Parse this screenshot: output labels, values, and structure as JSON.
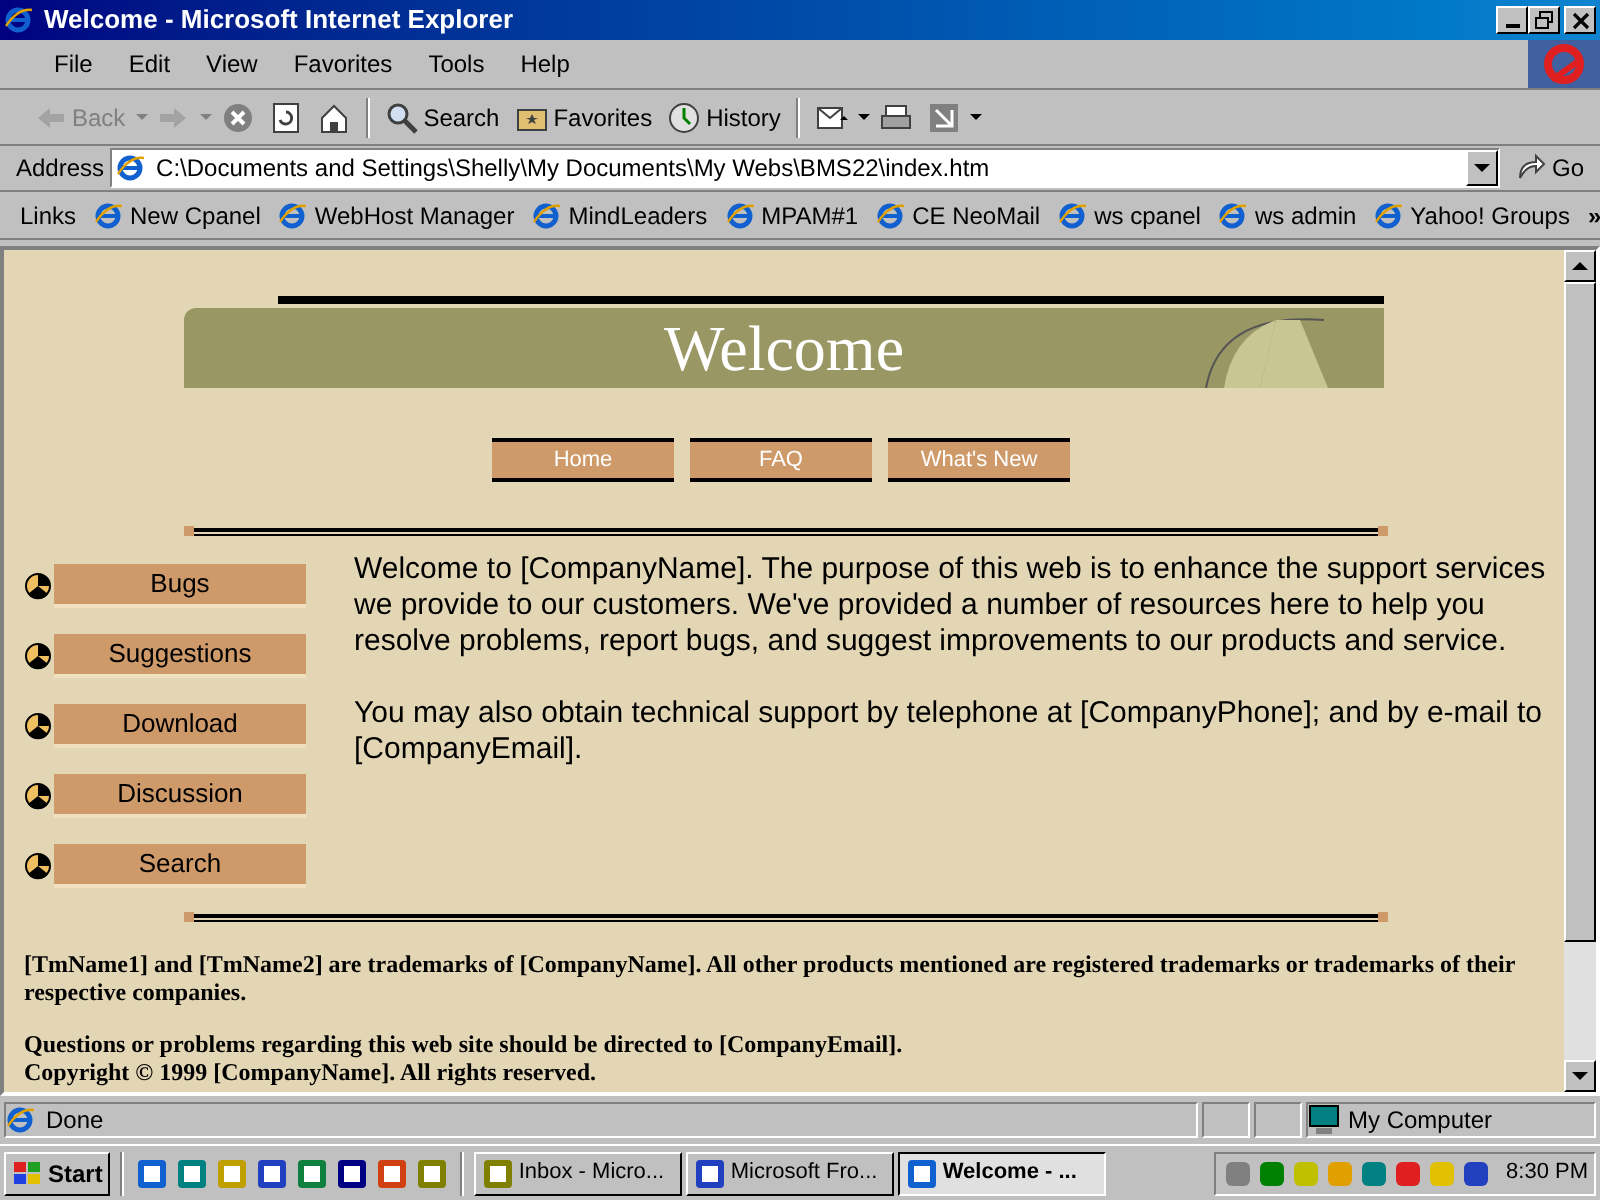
{
  "window": {
    "title": "Welcome - Microsoft Internet Explorer"
  },
  "menu": [
    "File",
    "Edit",
    "View",
    "Favorites",
    "Tools",
    "Help"
  ],
  "toolbar": [
    {
      "kind": "back",
      "label": "Back",
      "disabled": true
    },
    {
      "kind": "forward",
      "disabled": true
    },
    {
      "kind": "stop",
      "disabled": false
    },
    {
      "kind": "refresh",
      "disabled": false
    },
    {
      "kind": "home",
      "disabled": false
    },
    {
      "kind": "search",
      "label": "Search",
      "disabled": false
    },
    {
      "kind": "favorites",
      "label": "Favorites",
      "disabled": false
    },
    {
      "kind": "history",
      "label": "History",
      "disabled": false
    },
    {
      "kind": "mail",
      "disabled": false
    },
    {
      "kind": "print",
      "disabled": false
    },
    {
      "kind": "edit",
      "disabled": false
    }
  ],
  "address": {
    "label": "Address",
    "value": "C:\\Documents and Settings\\Shelly\\My Documents\\My Webs\\BMS22\\index.htm",
    "go": "Go"
  },
  "links": {
    "label": "Links",
    "items": [
      "New Cpanel",
      "WebHost Manager",
      "MindLeaders",
      "MPAM#1",
      "CE NeoMail",
      "ws cpanel",
      "ws admin",
      "Yahoo! Groups"
    ],
    "more": "»"
  },
  "page": {
    "banner": "Welcome",
    "top_nav": [
      "Home",
      "FAQ",
      "What's New"
    ],
    "side_nav": [
      "Bugs",
      "Suggestions",
      "Download",
      "Discussion",
      "Search"
    ],
    "paragraphs": [
      "Welcome to [CompanyName]. The purpose of this web is to enhance the support services we provide to our customers. We've provided a number of resources here to help you resolve problems, report bugs, and suggest improvements to our products and service.",
      "You may also obtain technical support by telephone at [CompanyPhone]; and by e-mail to [CompanyEmail]."
    ],
    "footer": [
      "[TmName1] and [TmName2] are trademarks of [CompanyName]. All other products mentioned are registered trademarks or trademarks of their respective companies.",
      "Questions or problems regarding this web site should be directed to [CompanyEmail].",
      "Copyright © 1999 [CompanyName]. All rights reserved."
    ]
  },
  "status_bar": {
    "text": "Done",
    "zone": "My Computer"
  },
  "taskbar": {
    "start": "Start",
    "quick_launch": [
      {
        "color": "#1060d0"
      },
      {
        "color": "#008080"
      },
      {
        "color": "#c0a000"
      },
      {
        "color": "#2040c0"
      },
      {
        "color": "#108040"
      },
      {
        "color": "#000080"
      },
      {
        "color": "#d04010"
      },
      {
        "color": "#808000"
      }
    ],
    "tasks": [
      {
        "label": "Inbox - Micro...",
        "selected": false,
        "color": "#808000"
      },
      {
        "label": "Microsoft Fro...",
        "selected": false,
        "color": "#2040c0"
      },
      {
        "label": "Welcome - ...",
        "selected": true,
        "color": "#1060d0"
      }
    ],
    "clock": "8:30 PM"
  }
}
